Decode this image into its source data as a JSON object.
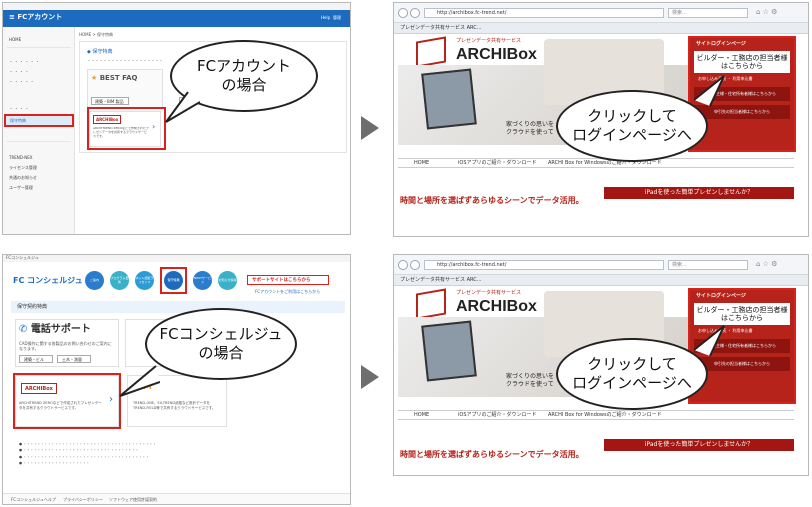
{
  "callouts": {
    "fc_account": [
      "FCアカウント",
      "の場合"
    ],
    "fc_concierge": [
      "FCコンシェルジュ",
      "の場合"
    ],
    "click_login_1": [
      "クリックして",
      "ログインページへ"
    ],
    "click_login_2": [
      "クリックして",
      "ログインページへ"
    ]
  },
  "fc_account_window": {
    "title": "FCアカウント",
    "breadcrumb": "HOME > 保守特典",
    "section_title": "保守特典",
    "best_faq": "BEST FAQ",
    "faq_tab": "建築・BIM 製品",
    "archibox_label": "ARCHIBox",
    "archibox_desc": "ARCHITREND ZEROなどで作成されたプレゼンデータを共有するクラウドサービスです。",
    "sidebar": [
      "HOME",
      "保守特典",
      "TREND-NEX",
      "ライセンス管理",
      "共通のお知らせ",
      "ユーザー管理"
    ],
    "header_right": [
      "Help",
      "管理"
    ]
  },
  "concierge_window": {
    "title": "FCコンシェルジュ",
    "logo": "コンシェルジュ",
    "nav": [
      "ご案内",
      "プログラム更新",
      "ネット認証ライセンス",
      "保守特典",
      "NEXTサービス",
      "お知らせ情報"
    ],
    "support_link": "サポートサイトはこちらから",
    "support_sub": "FCアカウントをご利用はこちらから",
    "section_title": "保守契約特典",
    "phone_support": "電話サポート",
    "phone_desc": "CAD操作に関する各製品のお問い合わせのご案内になります。",
    "phone_tags": [
      "建築・ビル",
      "土木・測量"
    ],
    "archibox_label": "ARCHIBox",
    "archibox_desc": "ARCHITREND ZEROなどで作成されたプレゼンデータを共有するクラウドサービスです。",
    "cim_label": "CIM",
    "cim_desc": "TREND-ONE、EX-TREND武蔵など設計データをTREND-FIELD等で共有するクラウドサービスです。",
    "footer_links": [
      "FCコンシェルジュヘルプ",
      "プライバシーポリシー",
      "ソフトウェア使用許諾契約"
    ]
  },
  "browser": {
    "url": "http://archibox.fc-trend.net/",
    "search_placeholder": "検索...",
    "tab_title": "プレゼンデータ共有サービス ARC...",
    "service_caption": "プレゼンデータ共有サービス",
    "logo": "ARCHIBox",
    "site_login_title": "サイトログインページ",
    "builder_text": "ビルダー・工務店の担当者様はこちらから",
    "apply_text": "お申し込み手続 ・ 利用申込書",
    "owner_text": "新築主様・住宅所有者様はこちらから",
    "applicant_text": "申引先の担当者様はこちらから",
    "tagline": "家づくりの思いを\nクラウドを使って",
    "nav": [
      "HOME",
      "iOSアプリのご紹介・ダウンロード",
      "ARCHI Box for Windowsのご紹介・ダウンロード"
    ],
    "headline": "時間と場所を選ばずあらゆるシーンでデータ活用。",
    "ipad_banner": "iPadを使った簡単プレゼンしませんか？"
  },
  "colors": {
    "highlight": "#d9221c",
    "brand_red": "#b5231a",
    "arrow": "#6e6e6e",
    "nav_blue": "#2a7ccd"
  }
}
